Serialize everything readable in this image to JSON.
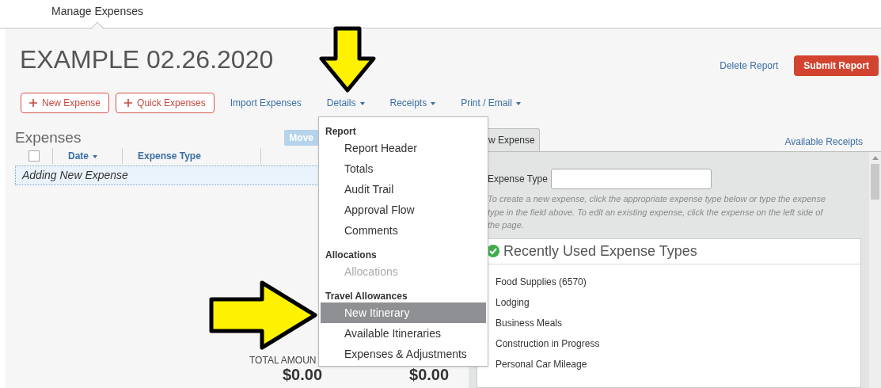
{
  "nav": {
    "tabs": [
      {
        "label": "Manage Expenses",
        "selected": true
      }
    ]
  },
  "report": {
    "title": "EXAMPLE 02.26.2020",
    "actions": [
      {
        "label": "Delete Report",
        "kind": "link"
      },
      {
        "label": "Submit Report",
        "kind": "primary"
      }
    ]
  },
  "toolbar": [
    {
      "label": "New Expense",
      "kind": "add"
    },
    {
      "label": "Quick Expenses",
      "kind": "add"
    },
    {
      "label": "Import Expenses",
      "kind": "link"
    },
    {
      "label": "Details",
      "kind": "menu"
    },
    {
      "label": "Receipts",
      "kind": "menu"
    },
    {
      "label": "Print / Email",
      "kind": "menu"
    }
  ],
  "expenses": {
    "title": "Expenses",
    "move_button": "Move",
    "header_checked": false,
    "columns": [
      {
        "label": "Date",
        "sorted": true
      },
      {
        "label": "Expense Type",
        "sorted": false
      }
    ],
    "rows": [
      {
        "label": "Adding New Expense",
        "selected": true
      }
    ],
    "totals": [
      {
        "label": "TOTAL AMOUN",
        "value": "$0.00"
      },
      {
        "value": "$0.00"
      }
    ]
  },
  "details_menu": {
    "sections": [
      {
        "heading": "Report",
        "items": [
          {
            "label": "Report Header",
            "disabled": false,
            "selected": false
          },
          {
            "label": "Totals",
            "disabled": false,
            "selected": false
          },
          {
            "label": "Audit Trail",
            "disabled": false,
            "selected": false
          },
          {
            "label": "Approval Flow",
            "disabled": false,
            "selected": false
          },
          {
            "label": "Comments",
            "disabled": false,
            "selected": false
          }
        ]
      },
      {
        "heading": "Allocations",
        "items": [
          {
            "label": "Allocations",
            "disabled": true,
            "selected": false
          }
        ]
      },
      {
        "heading": "Travel Allowances",
        "items": [
          {
            "label": "New Itinerary",
            "disabled": false,
            "selected": true
          },
          {
            "label": "Available Itineraries",
            "disabled": false,
            "selected": false
          },
          {
            "label": "Expenses & Adjustments",
            "disabled": false,
            "selected": false
          }
        ]
      }
    ]
  },
  "new_expense": {
    "tab": {
      "label": "w Expense",
      "selected": true
    },
    "receipts_link": "Available Receipts",
    "field_label": "Expense Type",
    "hint": "To create a new expense, click the appropriate expense type below or type the expense type in the field above. To edit an existing expense, click the expense on the left side of the page.",
    "recent": {
      "title": "Recently Used Expense Types",
      "items": [
        "Food Supplies (6570)",
        "Lodging",
        "Business Meals",
        "Construction in Progress",
        "Personal Car Mileage"
      ]
    }
  }
}
